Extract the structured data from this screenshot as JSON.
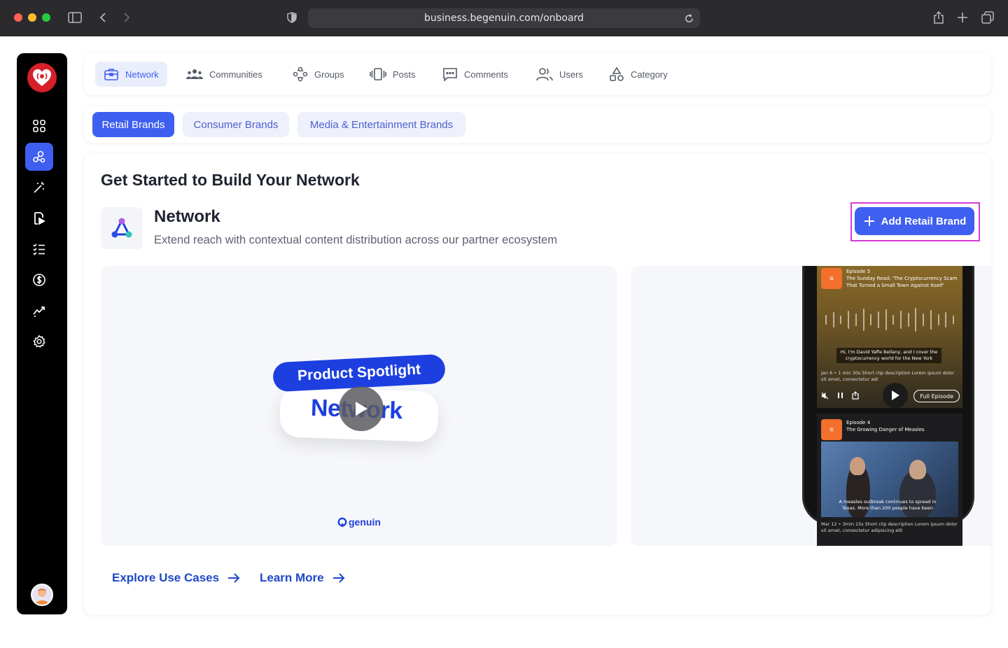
{
  "browser": {
    "url": "business.begenuin.com/onboard"
  },
  "tabs": [
    {
      "label": "Network",
      "icon": "briefcase-icon",
      "active": true
    },
    {
      "label": "Communities",
      "icon": "people-icon"
    },
    {
      "label": "Groups",
      "icon": "groups-icon"
    },
    {
      "label": "Posts",
      "icon": "vibrate-icon"
    },
    {
      "label": "Comments",
      "icon": "comment-icon"
    },
    {
      "label": "Users",
      "icon": "users-icon"
    },
    {
      "label": "Category",
      "icon": "shapes-icon"
    }
  ],
  "subtabs": [
    {
      "label": "Retail Brands",
      "active": true
    },
    {
      "label": "Consumer Brands"
    },
    {
      "label": "Media & Entertainment Brands"
    }
  ],
  "main": {
    "title": "Get Started to Build Your Network",
    "section_title": "Network",
    "section_desc": "Extend reach with contextual content distribution across our partner ecosystem",
    "add_button": "Add Retail Brand"
  },
  "video": {
    "pill": "Product Spotlight",
    "word": "Network",
    "brand": "genuin"
  },
  "phone": {
    "ep1_label": "Episode 5",
    "ep1_title": "The Sunday Read: 'The Cryptocurrency Scam That Turned a Small Town Against Itself'",
    "ep1_caption": "Hi, I'm David Yaffe Bellany, and I cover the cryptocurrency world for the New York",
    "ep1_meta": "Jan 6 • 1 min 30s  Short clip description Lorem ipsum dolor sit amet, consectetur adi",
    "full_episode": "Full Episode",
    "ep2_label": "Episode 4",
    "ep2_title": "The Growing Danger of Measles",
    "ep2_caption": "A measles outbreak continues to spread in Texas. More than 200 people have been",
    "ep2_meta": "Mar 12 • 3min 15s  Short clip description Lorem ipsum dolor sit amet, consectetur adipiscing elit"
  },
  "links": {
    "explore": "Explore Use Cases",
    "learn": "Learn More"
  },
  "colors": {
    "accent": "#3e5ff0",
    "highlight": "#d63bd6",
    "sidebar": "#000000"
  }
}
